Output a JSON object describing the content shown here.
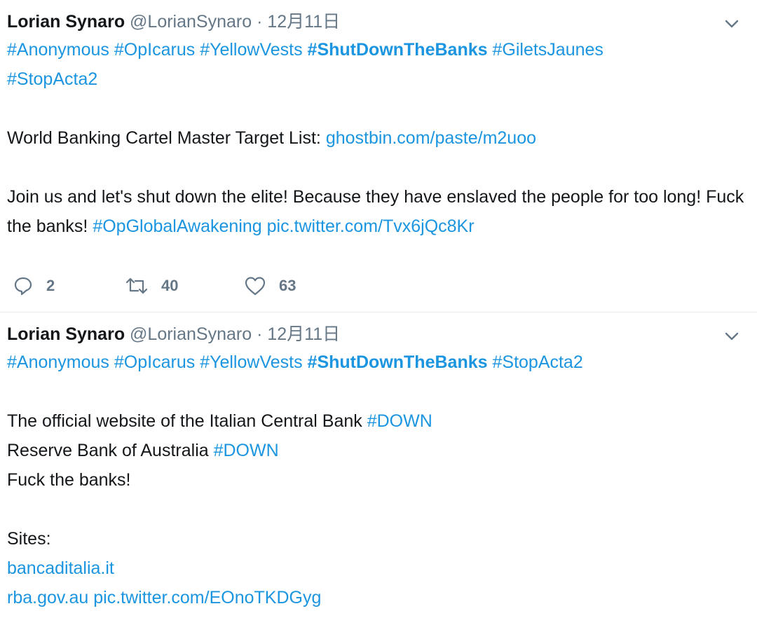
{
  "tweets": [
    {
      "name": "Lorian Synaro",
      "handle": "@LorianSynaro",
      "separator": "·",
      "time": "12月11日",
      "hashtags": [
        "#Anonymous",
        "#OpIcarus",
        "#YellowVests",
        "#ShutDownTheBanks",
        "#GiletsJaunes",
        "#StopActa2"
      ],
      "list_text": "World Banking Cartel Master Target List: ",
      "list_link": "ghostbin.com/paste/m2uoo",
      "body_text": "Join us and let's shut down the elite! Because they have enslaved the people for too long! Fuck the banks! ",
      "body_hashtag": "#OpGlobalAwakening",
      "pic_link": "pic.twitter.com/Tvx6jQc8Kr",
      "reply_count": "2",
      "retweet_count": "40",
      "like_count": "63"
    },
    {
      "name": "Lorian Synaro",
      "handle": "@LorianSynaro",
      "separator": "·",
      "time": "12月11日",
      "hashtags": [
        "#Anonymous",
        "#OpIcarus",
        "#YellowVests",
        "#ShutDownTheBanks",
        "#StopActa2"
      ],
      "line1_text": "The official website of the Italian Central Bank ",
      "line1_tag": "#DOWN",
      "line2_text": "Reserve Bank of Australia ",
      "line2_tag": "#DOWN",
      "line3_text": "Fuck the banks!",
      "sites_label": "Sites:",
      "site1": "bancaditalia.it",
      "site2": "rba.gov.au",
      "pic_link": "pic.twitter.com/EOnoTKDGyg"
    }
  ],
  "colors": {
    "link": "#1b95e0",
    "muted": "#657786",
    "text": "#14171a"
  },
  "icons": {
    "menu": "chevron-down-icon",
    "reply": "reply-icon",
    "retweet": "retweet-icon",
    "like": "heart-icon"
  }
}
